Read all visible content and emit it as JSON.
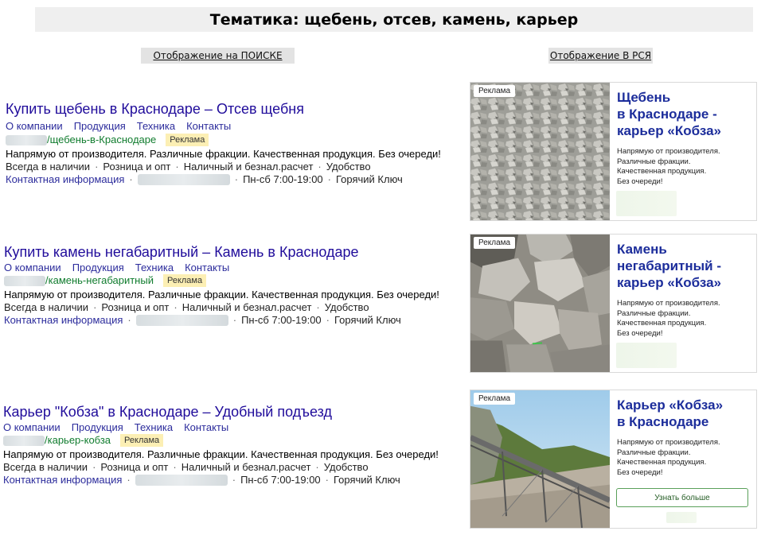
{
  "header": {
    "title": "Тематика: щебень, отсев, камень, карьер"
  },
  "labels": {
    "search": "Отображение на ПОИСКЕ",
    "rsya": "Отображение В РСЯ"
  },
  "search_ads": [
    {
      "title": "Купить щебень в Краснодаре – Отсев щебня",
      "links": [
        "О компании",
        "Продукция",
        "Техника",
        "Контакты"
      ],
      "url_path": "/щебень-в-Краснодаре",
      "badge": "Реклама",
      "description": "Напрямую от производителя. Различные фракции. Качественная продукция. Без очереди!",
      "features": [
        "Всегда в наличии",
        "Розница и опт",
        "Наличный и безнал.расчет",
        "Удобство"
      ],
      "contact_link": "Контактная информация",
      "hours": "Пн-сб 7:00-19:00",
      "city": "Горячий Ключ"
    },
    {
      "title": "Купить камень негабаритный – Камень в Краснодаре",
      "links": [
        "О компании",
        "Продукция",
        "Техника",
        "Контакты"
      ],
      "url_path": "/камень-негабаритный",
      "badge": "Реклама",
      "description": "Напрямую от производителя. Различные фракции. Качественная продукция. Без очереди!",
      "features": [
        "Всегда в наличии",
        "Розница и опт",
        "Наличный и безнал.расчет",
        "Удобство"
      ],
      "contact_link": "Контактная информация",
      "hours": "Пн-сб 7:00-19:00",
      "city": "Горячий Ключ"
    },
    {
      "title": "Карьер \"Кобза\" в Краснодаре – Удобный подъезд",
      "links": [
        "О компании",
        "Продукция",
        "Техника",
        "Контакты"
      ],
      "url_path": "/карьер-кобза",
      "badge": "Реклама",
      "description": "Напрямую от производителя. Различные фракции. Качественная продукция. Без очереди!",
      "features": [
        "Всегда в наличии",
        "Розница и опт",
        "Наличный и безнал.расчет",
        "Удобство"
      ],
      "contact_link": "Контактная информация",
      "hours": "Пн-сб 7:00-19:00",
      "city": "Горячий Ключ"
    }
  ],
  "rsya_ads": [
    {
      "ad_label": "Реклама",
      "title_lines": [
        "Щебень",
        "в Краснодаре -",
        "карьер «Кобза»"
      ],
      "desc_lines": [
        "Напрямую от производителя.",
        "Различные фракции.",
        "Качественная продукция.",
        "Без очереди!"
      ]
    },
    {
      "ad_label": "Реклама",
      "title_lines": [
        "Камень",
        "негабаритный -",
        "карьер «Кобза»"
      ],
      "desc_lines": [
        "Напрямую от производителя.",
        "Различные фракции.",
        "Качественная продукция.",
        "Без очереди!"
      ]
    },
    {
      "ad_label": "Реклама",
      "title_lines": [
        "Карьер «Кобза»",
        "в Краснодаре"
      ],
      "desc_lines": [
        "Напрямую от производителя.",
        "Различные фракции.",
        "Качественная продукция.",
        "Без очереди!"
      ],
      "button": "Узнать больше"
    }
  ]
}
